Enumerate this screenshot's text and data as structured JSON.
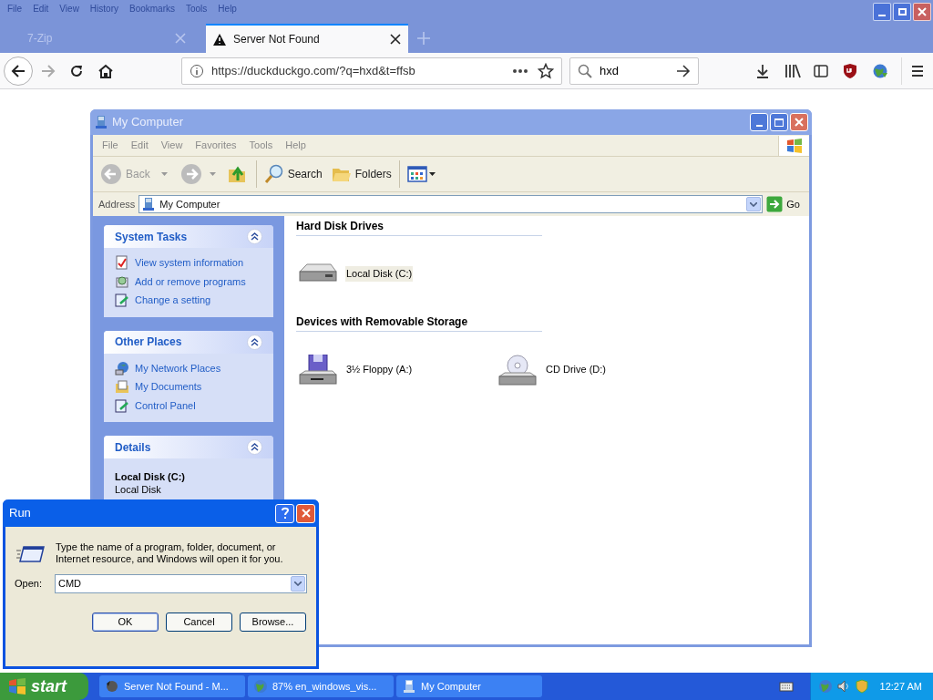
{
  "browser": {
    "menu": [
      "File",
      "Edit",
      "View",
      "History",
      "Bookmarks",
      "Tools",
      "Help"
    ],
    "tabs": [
      {
        "label": "7-Zip",
        "selected": false
      },
      {
        "label": "Server Not Found",
        "selected": true
      }
    ],
    "url": "https://duckduckgo.com/?q=hxd&t=ffsb",
    "search": "hxd"
  },
  "explorer": {
    "title": "My Computer",
    "menu": [
      "File",
      "Edit",
      "View",
      "Favorites",
      "Tools",
      "Help"
    ],
    "back": "Back",
    "search": "Search",
    "folders": "Folders",
    "address_label": "Address",
    "address": "My Computer",
    "go": "Go",
    "panels": [
      {
        "title": "System Tasks",
        "links": [
          {
            "label": "View system information",
            "kind": "info"
          },
          {
            "label": "Add or remove programs",
            "kind": "programs"
          },
          {
            "label": "Change a setting",
            "kind": "setting"
          }
        ]
      },
      {
        "title": "Other Places",
        "links": [
          {
            "label": "My Network Places",
            "kind": "network"
          },
          {
            "label": "My Documents",
            "kind": "documents"
          },
          {
            "label": "Control Panel",
            "kind": "setting"
          }
        ]
      },
      {
        "title": "Details",
        "name": "Local Disk (C:)",
        "description": "Local Disk"
      }
    ],
    "groups": [
      {
        "title": "Hard Disk Drives",
        "items": [
          {
            "label": "Local Disk (C:)",
            "kind": "hdd",
            "selected": true
          }
        ]
      },
      {
        "title": "Devices with Removable Storage",
        "items": [
          {
            "label": "3½ Floppy (A:)",
            "kind": "floppy",
            "selected": false
          },
          {
            "label": "CD Drive (D:)",
            "kind": "cd",
            "selected": false
          }
        ]
      }
    ]
  },
  "run": {
    "title": "Run",
    "message": "Type the name of a program, folder, document, or Internet resource, and Windows will open it for you.",
    "open_label": "Open:",
    "value": "CMD",
    "buttons": [
      "OK",
      "Cancel",
      "Browse..."
    ]
  },
  "taskbar": {
    "start": "start",
    "tasks": [
      {
        "label": "Server Not Found - M...",
        "kind": "firefox"
      },
      {
        "label": "87% en_windows_vis...",
        "kind": "download"
      },
      {
        "label": "My Computer",
        "kind": "computer"
      }
    ],
    "clock": "12:27 AM"
  }
}
